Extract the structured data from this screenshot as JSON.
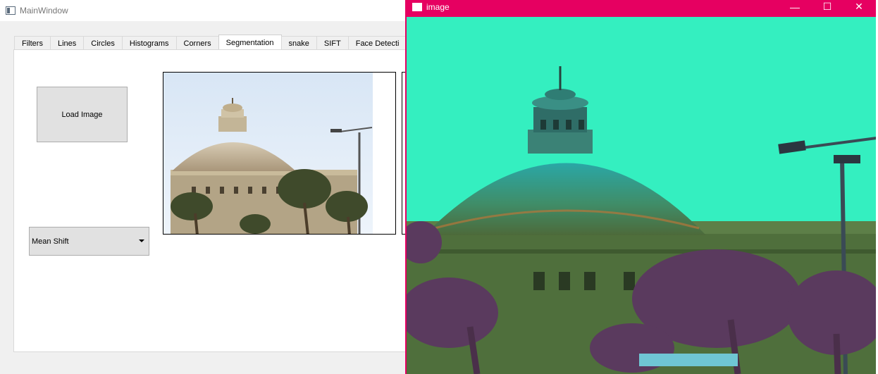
{
  "main_window": {
    "title": "MainWindow",
    "tabs": [
      "Filters",
      "Lines",
      "Circles",
      "Histograms",
      "Corners",
      "Segmentation",
      "snake",
      "SIFT",
      "Face Detecti"
    ],
    "active_tab": "Segmentation",
    "load_button_label": "Load Image",
    "method_select_value": "Mean Shift"
  },
  "image_window": {
    "title": "image",
    "minimize_glyph": "—",
    "maximize_glyph": "☐",
    "close_glyph": "✕",
    "titlebar_color": "#e60061",
    "tint_background": "#34efc0"
  }
}
